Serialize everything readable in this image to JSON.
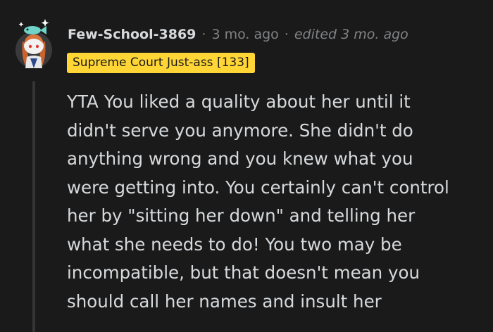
{
  "comment": {
    "author": "Few-School-3869",
    "separator": "·",
    "timestamp": "3 mo. ago",
    "edited": "edited 3 mo. ago",
    "flair": "Supreme Court Just-ass [133]",
    "avatar_icon": "snoo-avatar-icon",
    "body_lines": [
      "YTA You liked a quality about her until it",
      "didn't serve you anymore. She didn't do",
      "anything wrong and you knew what you",
      "were getting into. You certainly can't control",
      "her by \"sitting her down\" and telling her",
      "what she needs to do! You two may be",
      "incompatible, but that doesn't mean you",
      "should call her names and insult her"
    ]
  },
  "colors": {
    "background": "#1a1a1b",
    "text": "#d7dadc",
    "muted": "#818384",
    "flair_bg": "#ffd635",
    "thread_line": "#343536"
  }
}
